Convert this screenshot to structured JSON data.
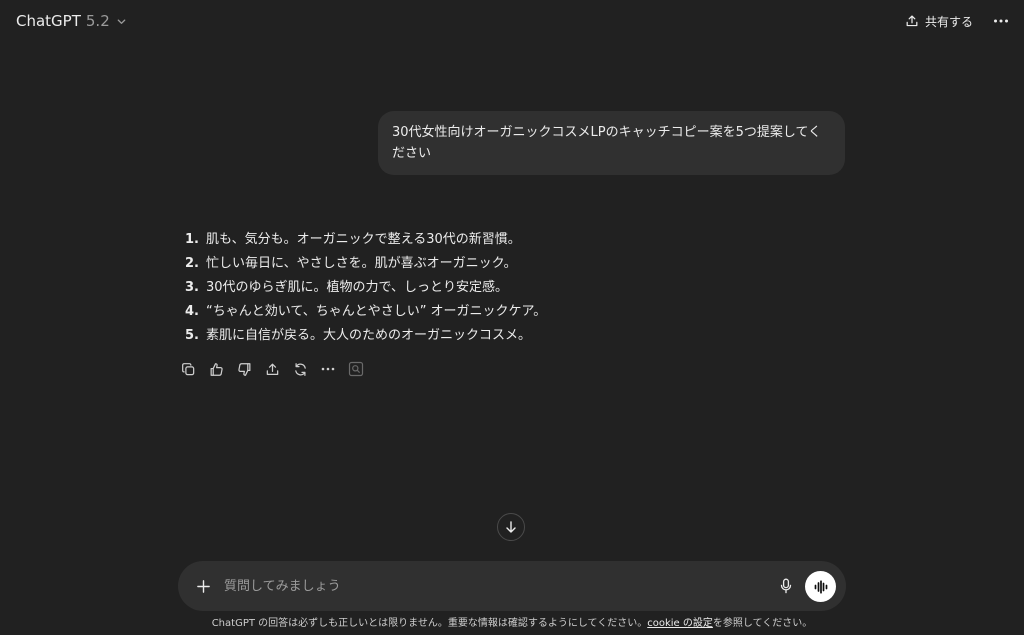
{
  "header": {
    "model_name": "ChatGPT",
    "model_version": "5.2",
    "share_label": "共有する"
  },
  "conversation": {
    "user_message": "30代女性向けオーガニックコスメLPのキャッチコピー案を5つ提案してください",
    "assistant_items": [
      {
        "num": "1.",
        "text": "肌も、気分も。オーガニックで整える30代の新習慣。"
      },
      {
        "num": "2.",
        "text": "忙しい毎日に、やさしさを。肌が喜ぶオーガニック。"
      },
      {
        "num": "3.",
        "text": "30代のゆらぎ肌に。植物の力で、しっとり安定感。"
      },
      {
        "num": "4.",
        "text": "“ちゃんと効いて、ちゃんとやさしい” オーガニックケア。"
      },
      {
        "num": "5.",
        "text": "素肌に自信が戻る。大人のためのオーガニックコスメ。"
      }
    ]
  },
  "actions": [
    "copy-icon",
    "thumbs-up-icon",
    "thumbs-down-icon",
    "share-icon",
    "regenerate-icon",
    "more-icon",
    "search-icon"
  ],
  "composer": {
    "placeholder": "質問してみましょう"
  },
  "footer": {
    "disclaimer_before": "ChatGPT の回答は必ずしも正しいとは限りません。重要な情報は確認するようにしてください。",
    "cookie_link": "cookie の設定",
    "disclaimer_after": "を参照してください。"
  },
  "colors": {
    "background": "#212121",
    "bubble": "#303030",
    "text": "#ececec",
    "muted": "#9b9b9b"
  }
}
